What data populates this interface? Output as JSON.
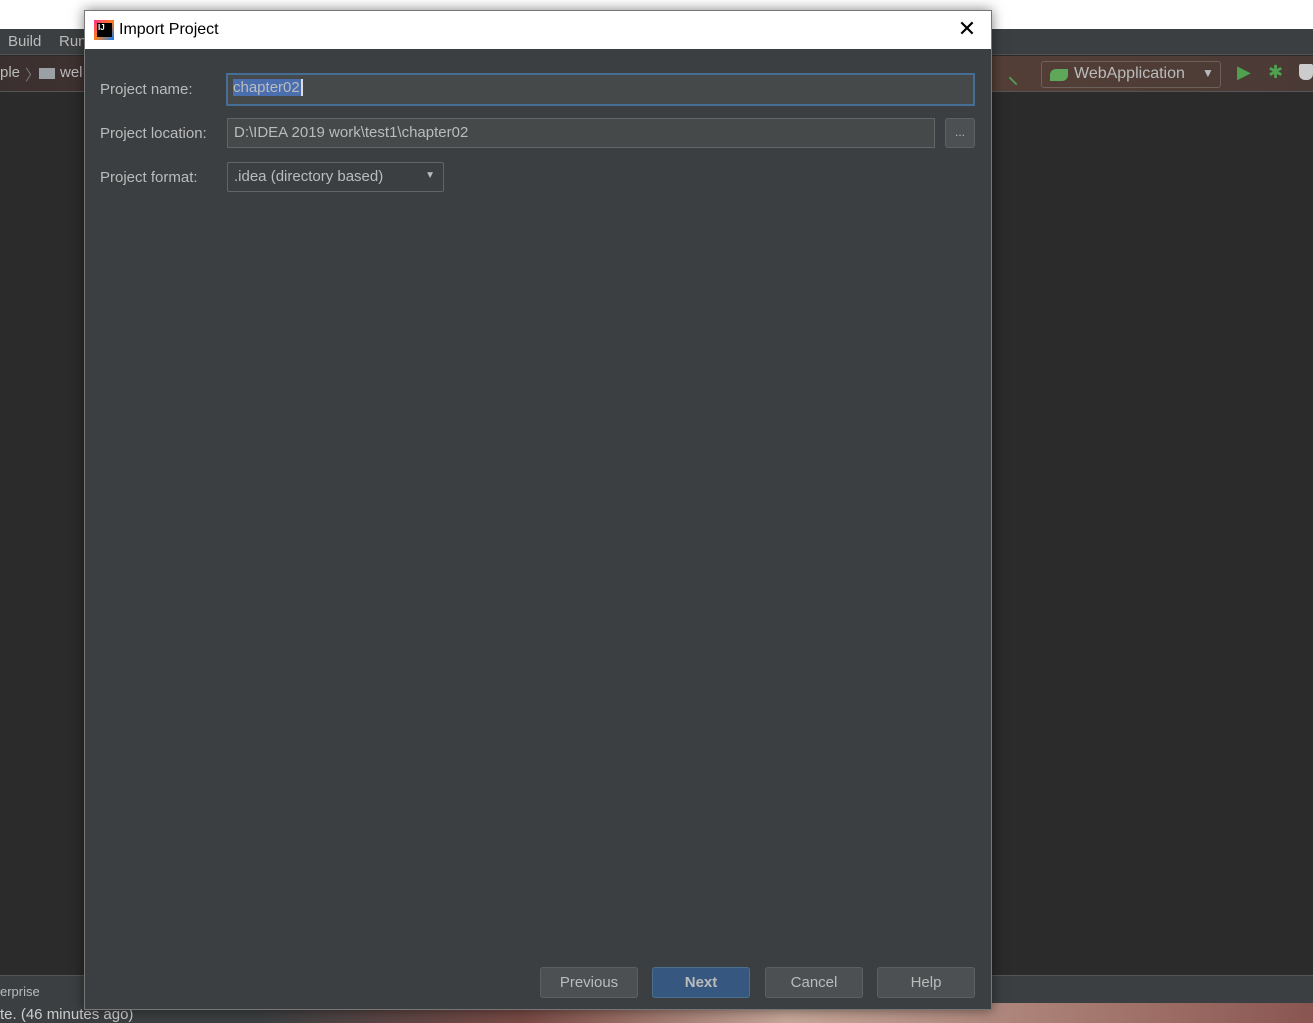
{
  "ide": {
    "menu": [
      "Build",
      "Run"
    ],
    "breadcrumb": [
      "ple",
      "wel"
    ],
    "run_config": "WebApplication",
    "status_left": "erprise",
    "status_text": "te. (46 minutes ago)"
  },
  "dialog": {
    "title": "Import Project",
    "project_name_label": "Project name:",
    "project_name_value": "chapter02",
    "project_location_label": "Project location:",
    "project_location_value": "D:\\IDEA 2019 work\\test1\\chapter02",
    "browse_label": "...",
    "project_format_label": "Project format:",
    "project_format_value": ".idea (directory based)",
    "buttons": {
      "previous": "Previous",
      "next": "Next",
      "cancel": "Cancel",
      "help": "Help"
    }
  },
  "colors": {
    "accent": "#365880",
    "selection": "#4b6eaf",
    "run_green": "#4fa04f"
  }
}
